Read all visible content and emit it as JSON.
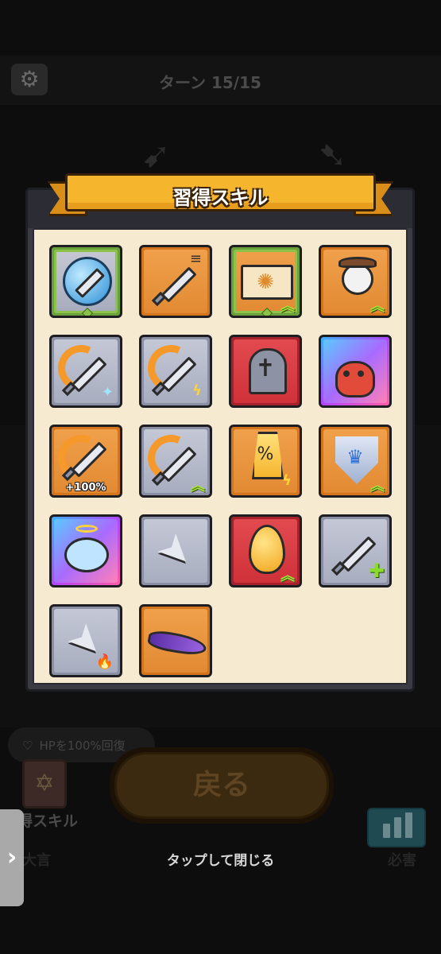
{
  "background": {
    "turn_label": "ターン 15/15",
    "hint_text": "HPを100%回復",
    "book_label": "得スキル",
    "left_bottom_label": "大言",
    "stats_label": "必害"
  },
  "modal": {
    "title": "習得スキル",
    "back_label": "戻る",
    "tap_to_close": "タップして閉じる"
  },
  "skills": [
    {
      "name": "bubble-sword",
      "tile": "green",
      "marker": "diamond"
    },
    {
      "name": "dash-sword",
      "tile": "orange"
    },
    {
      "name": "spell-book",
      "tile": "greenorange",
      "marker": "diamond",
      "upgrade": true
    },
    {
      "name": "panda-ninja",
      "tile": "orange",
      "upgrade": true
    },
    {
      "name": "flame-sword-ice",
      "tile": "gray"
    },
    {
      "name": "flame-sword-lightning",
      "tile": "gray"
    },
    {
      "name": "gravestone",
      "tile": "red"
    },
    {
      "name": "red-beast",
      "tile": "rainbow"
    },
    {
      "name": "flame-sword-plus100",
      "tile": "orange",
      "badge": "+100%"
    },
    {
      "name": "flame-sword-upgrade",
      "tile": "gray",
      "upgrade": true
    },
    {
      "name": "crit-percent",
      "tile": "orange"
    },
    {
      "name": "crown-shield",
      "tile": "orange",
      "upgrade": true
    },
    {
      "name": "angel-dragon",
      "tile": "rainbow"
    },
    {
      "name": "kunai",
      "tile": "gray"
    },
    {
      "name": "golden-egg",
      "tile": "red",
      "upgrade": true
    },
    {
      "name": "shadow-sword-plus",
      "tile": "gray"
    },
    {
      "name": "fire-kunai",
      "tile": "gray"
    },
    {
      "name": "purple-scarf",
      "tile": "orange"
    }
  ]
}
